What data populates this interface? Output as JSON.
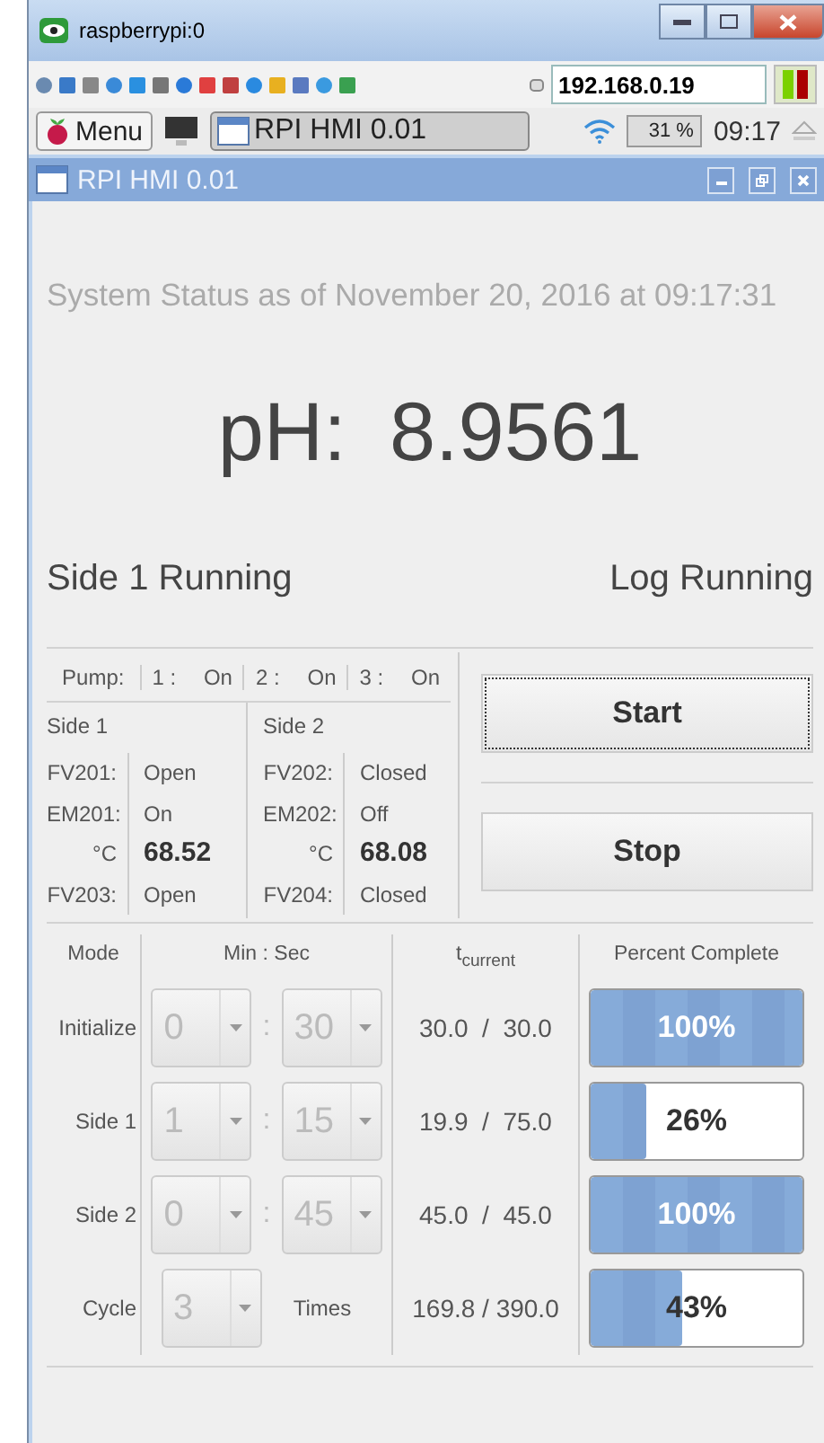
{
  "vnc_window": {
    "title": "raspberrypi:0"
  },
  "vnc_toolbar": {
    "host": "192.168.0.19"
  },
  "taskbar": {
    "menu": "Menu",
    "task": "RPI HMI 0.01",
    "cpu": "31 %",
    "clock": "09:17"
  },
  "app_window": {
    "title": "RPI HMI 0.01"
  },
  "status": "System Status as of November 20, 2016 at 09:17:31",
  "ph": {
    "label": "pH:",
    "value": "8.9561"
  },
  "side_status": "Side 1 Running",
  "log_status": "Log Running",
  "pumps": {
    "label": "Pump:",
    "items": [
      {
        "number": "1 :",
        "state": "On"
      },
      {
        "number": "2 :",
        "state": "On"
      },
      {
        "number": "3 :",
        "state": "On"
      }
    ]
  },
  "sides": [
    {
      "title": "Side 1",
      "rows": [
        {
          "label": "FV201:",
          "value": "Open",
          "kind": "plain"
        },
        {
          "label": "EM201:",
          "value": "On",
          "kind": "plain"
        },
        {
          "label": "°C",
          "value": "68.52",
          "kind": "temperature"
        },
        {
          "label": "FV203:",
          "value": "Open",
          "kind": "plain"
        }
      ]
    },
    {
      "title": "Side 2",
      "rows": [
        {
          "label": "FV202:",
          "value": "Closed",
          "kind": "plain"
        },
        {
          "label": "EM202:",
          "value": "Off",
          "kind": "plain"
        },
        {
          "label": "°C",
          "value": "68.08",
          "kind": "temperature"
        },
        {
          "label": "FV204:",
          "value": "Closed",
          "kind": "plain"
        }
      ]
    }
  ],
  "buttons": [
    {
      "label": "Start",
      "focused": true
    },
    {
      "label": "Stop",
      "focused": false
    }
  ],
  "schedule": {
    "inputs_disabled": true,
    "headers": {
      "mode": "Mode",
      "time": "Min : Sec",
      "current": "t$_{current}$",
      "percent": "Percent Complete"
    },
    "rows": [
      {
        "kind": "time",
        "mode": "Initialize",
        "min": "0",
        "separator": ":",
        "sec": "30",
        "elapsed": "30.0  /  30.0",
        "level": 1,
        "percent": "100%"
      },
      {
        "kind": "time",
        "mode": "Side 1",
        "min": "1",
        "separator": ":",
        "sec": "15",
        "elapsed": "19.9  /  75.0",
        "level": 0.26,
        "percent": "26%"
      },
      {
        "kind": "time",
        "mode": "Side 2",
        "min": "0",
        "separator": ":",
        "sec": "45",
        "elapsed": "45.0  /  45.0",
        "level": 1,
        "percent": "100%"
      },
      {
        "kind": "count",
        "mode": "Cycle",
        "count": "3",
        "unit": "Times",
        "elapsed": "169.8 / 390.0",
        "level": 0.43,
        "percent": "43%"
      }
    ]
  }
}
